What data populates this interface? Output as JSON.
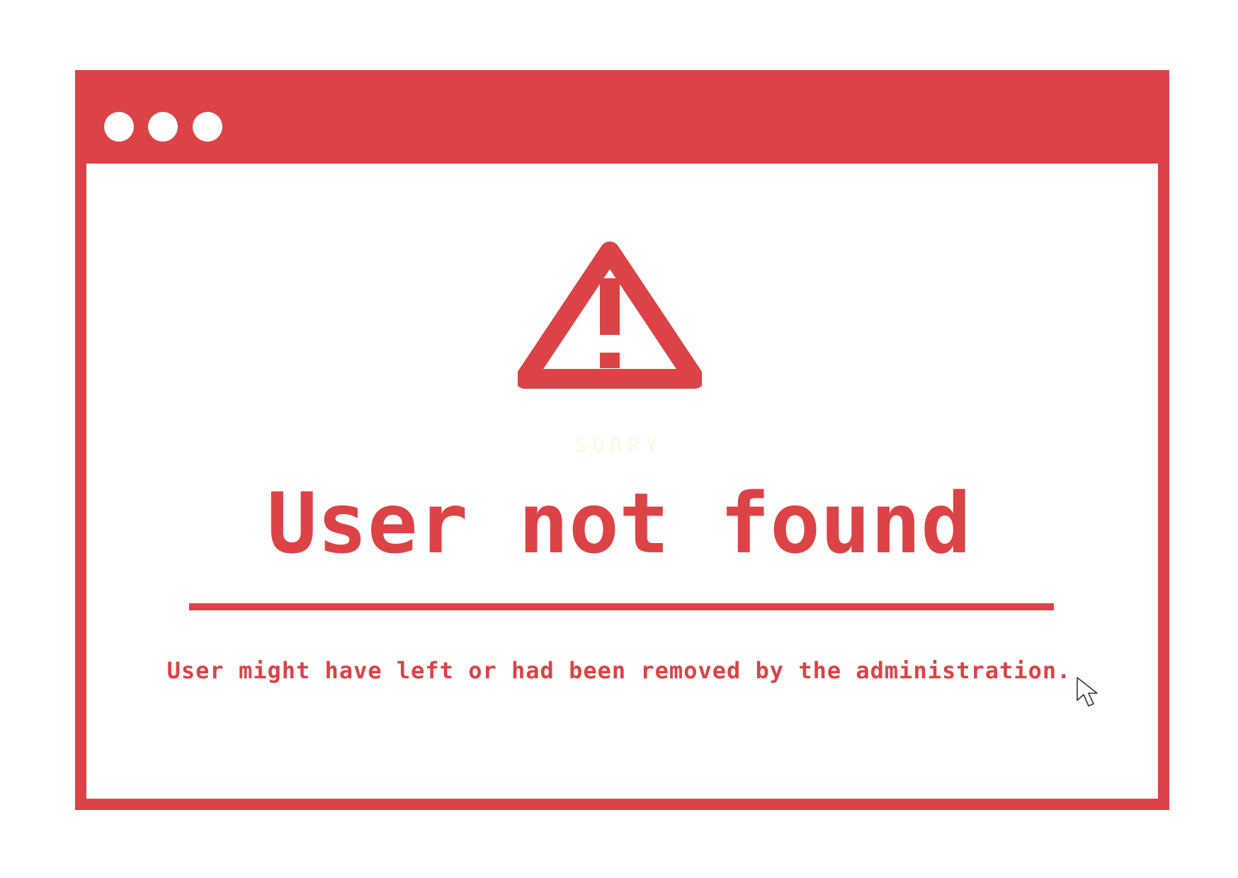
{
  "window": {
    "controls": [
      {
        "name": "window-dot-1"
      },
      {
        "name": "window-dot-2"
      },
      {
        "name": "window-dot-3"
      }
    ]
  },
  "icons": {
    "warning": "warning-triangle-icon",
    "cursor": "mouse-pointer-icon"
  },
  "content": {
    "eyebrow": "SORRY",
    "title": "User not found",
    "message": "User might have left or had been removed by the administration."
  },
  "colors": {
    "accent": "#dc4346",
    "background": "#ffffff",
    "eyebrow": "#fbf7e0"
  }
}
